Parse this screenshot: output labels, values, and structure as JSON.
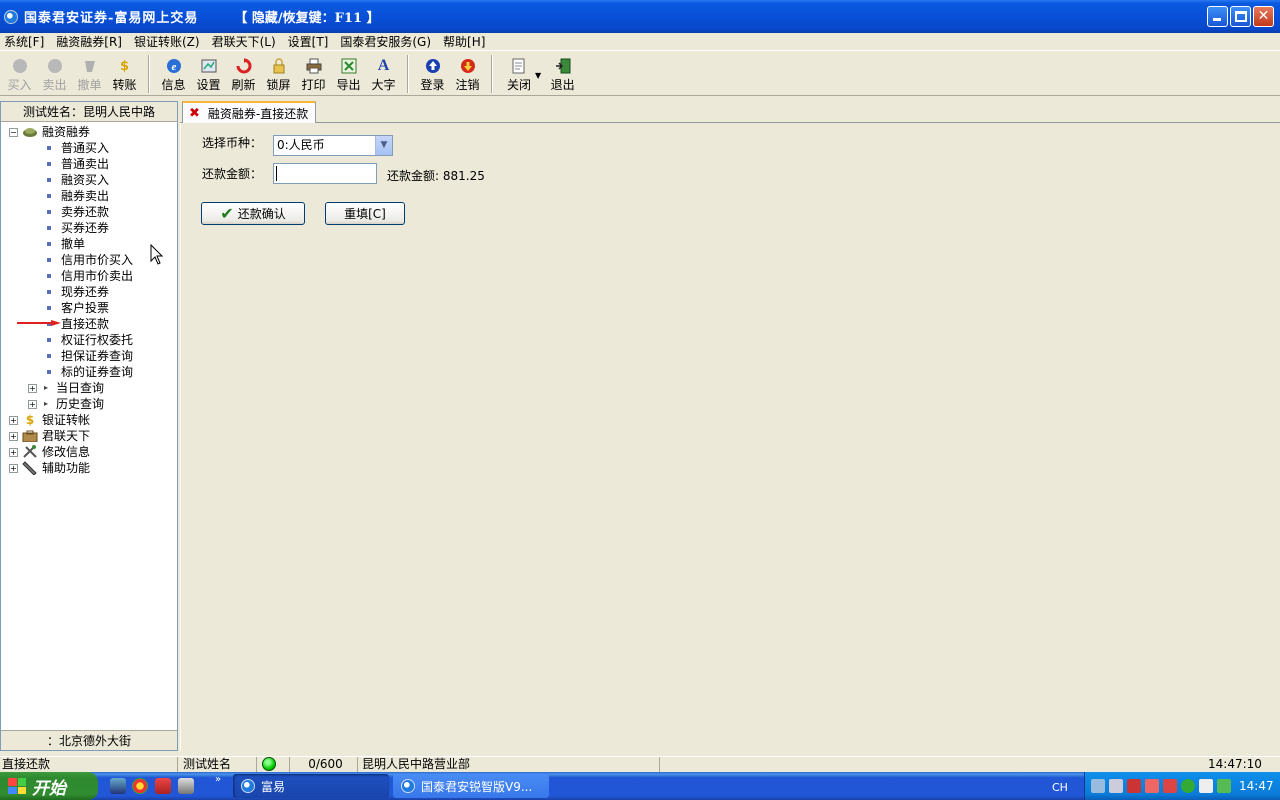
{
  "window": {
    "title": "国泰君安证券-富易网上交易",
    "hotkey_hint": "【 隐藏/恢复键：F11 】"
  },
  "menu": [
    {
      "label": "系统[F]"
    },
    {
      "label": "融资融券[R]"
    },
    {
      "label": "银证转账(Z)"
    },
    {
      "label": "君联天下(L)"
    },
    {
      "label": "设置[T]"
    },
    {
      "label": "国泰君安服务(G)"
    },
    {
      "label": "帮助[H]"
    }
  ],
  "toolbar": {
    "buy": "买入",
    "sell": "卖出",
    "cancel": "撤单",
    "transfer": "转账",
    "info": "信息",
    "settings": "设置",
    "refresh": "刷新",
    "lock": "锁屏",
    "print": "打印",
    "export": "导出",
    "bigfont": "大字",
    "login": "登录",
    "logout": "注销",
    "close": "关闭",
    "exit": "退出"
  },
  "left_panel": {
    "header": "测试姓名：昆明人民中路",
    "footer": "：北京德外大街",
    "tree": {
      "root": "融资融券",
      "items": [
        "普通买入",
        "普通卖出",
        "融资买入",
        "融券卖出",
        "卖券还款",
        "买券还券",
        "撤单",
        "信用市价买入",
        "信用市价卖出",
        "现券还券",
        "客户投票",
        "直接还款",
        "权证行权委托",
        "担保证券查询",
        "标的证券查询"
      ],
      "subgroups": [
        "当日查询",
        "历史查询"
      ],
      "groups": [
        "银证转帐",
        "君联天下",
        "修改信息",
        "辅助功能"
      ]
    }
  },
  "tab": {
    "label": "融资融券-直接还款"
  },
  "form": {
    "currency_label": "选择币种：",
    "currency_value": "0:人民币",
    "amount_label": "还款金额：",
    "amount_value": "",
    "amount_hint": "还款金额: 881.25",
    "confirm_button": "还款确认",
    "reset_button": "重填[C]"
  },
  "statusbar": {
    "function": "直接还款",
    "user": "测试姓名",
    "counter": "0/600",
    "branch": "昆明人民中路营业部",
    "time": "14:47:10"
  },
  "taskbar": {
    "start": "开始",
    "task1": "富易",
    "task2": "国泰君安锐智版V9...",
    "lang": "CH",
    "clock": "14:47"
  },
  "colors": {
    "titlebar": "#0a5ae0",
    "tab_highlight": "#f6b53a",
    "arrow": "#e02020",
    "status_ok": "#00cc00"
  }
}
